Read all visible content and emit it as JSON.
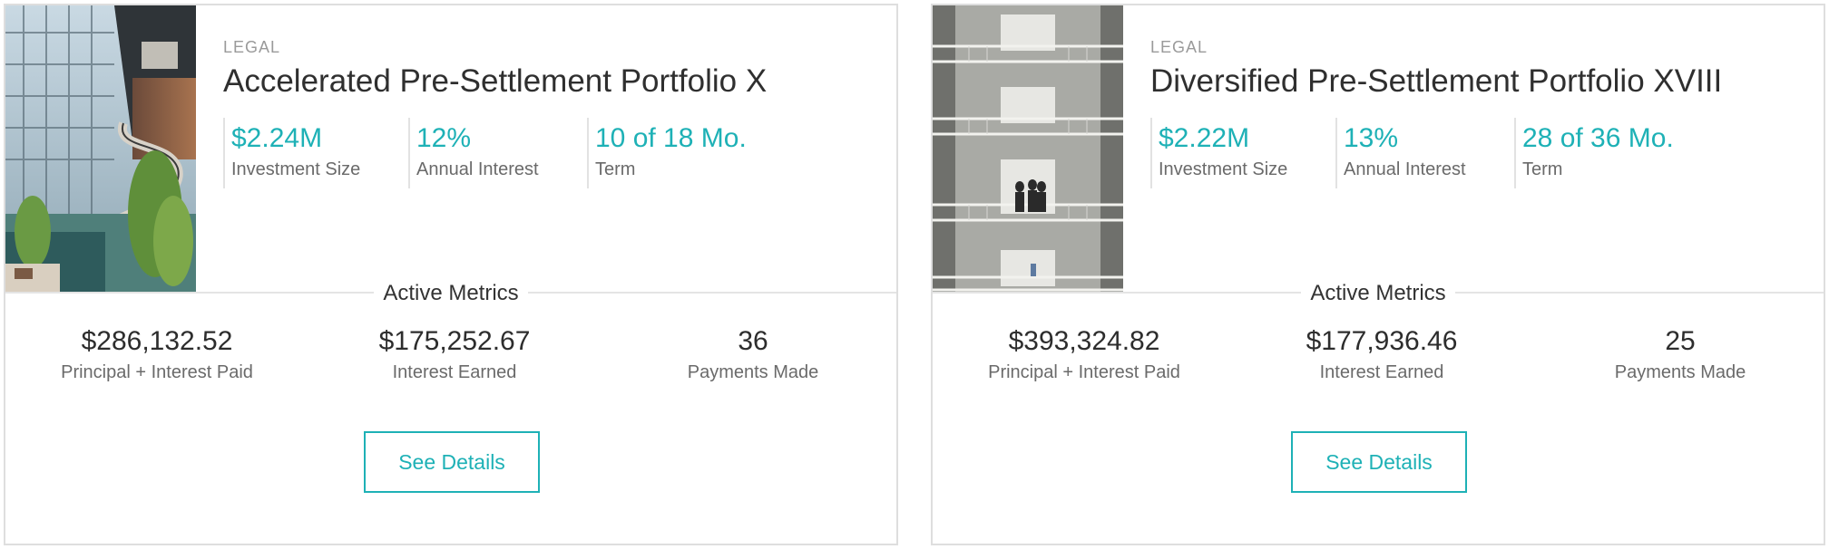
{
  "cards": [
    {
      "category": "LEGAL",
      "title": "Accelerated Pre-Settlement Portfolio X",
      "image_subject": "atrium-building-photo",
      "stats": [
        {
          "value": "$2.24M",
          "label": "Investment Size"
        },
        {
          "value": "12%",
          "label": "Annual Interest"
        },
        {
          "value": "10 of 18 Mo.",
          "label": "Term"
        }
      ],
      "metrics_heading": "Active Metrics",
      "metrics": [
        {
          "value": "$286,132.52",
          "label": "Principal + Interest Paid"
        },
        {
          "value": "$175,252.67",
          "label": "Interest Earned"
        },
        {
          "value": "36",
          "label": "Payments Made"
        }
      ],
      "button_label": "See Details"
    },
    {
      "category": "LEGAL",
      "title": "Diversified Pre-Settlement Portfolio XVIII",
      "image_subject": "building-balconies-photo",
      "stats": [
        {
          "value": "$2.22M",
          "label": "Investment Size"
        },
        {
          "value": "13%",
          "label": "Annual Interest"
        },
        {
          "value": "28 of 36 Mo.",
          "label": "Term"
        }
      ],
      "metrics_heading": "Active Metrics",
      "metrics": [
        {
          "value": "$393,324.82",
          "label": "Principal + Interest Paid"
        },
        {
          "value": "$177,936.46",
          "label": "Interest Earned"
        },
        {
          "value": "25",
          "label": "Payments Made"
        }
      ],
      "button_label": "See Details"
    }
  ],
  "colors": {
    "accent": "#1eb1b6",
    "border": "#dedede",
    "muted_text": "#6a6a6a",
    "category_text": "#9a9a9a"
  }
}
